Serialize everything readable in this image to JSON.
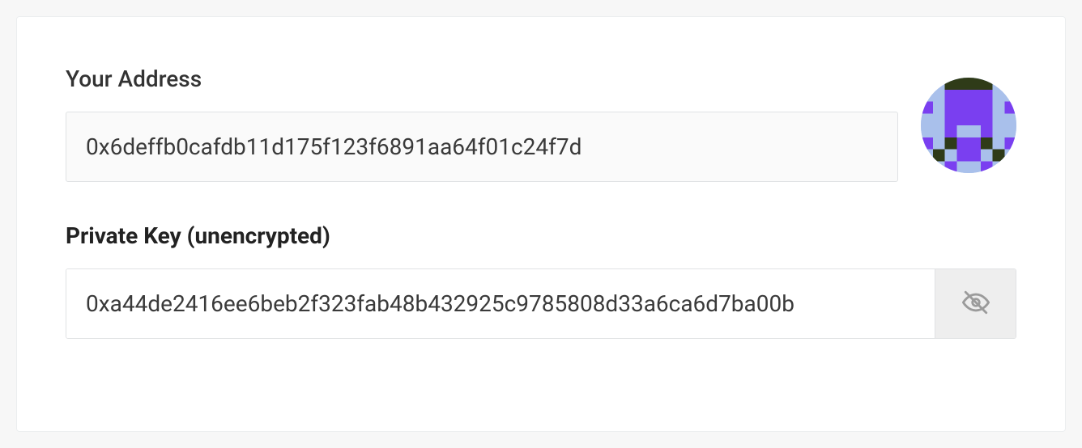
{
  "address": {
    "label": "Your Address",
    "value": "0x6deffb0cafdb11d175f123f6891aa64f01c24f7d"
  },
  "privateKey": {
    "label": "Private Key (unencrypted)",
    "value": "0xa44de2416ee6beb2f323fab48b432925c9785808d33a6ca6d7ba00b"
  }
}
